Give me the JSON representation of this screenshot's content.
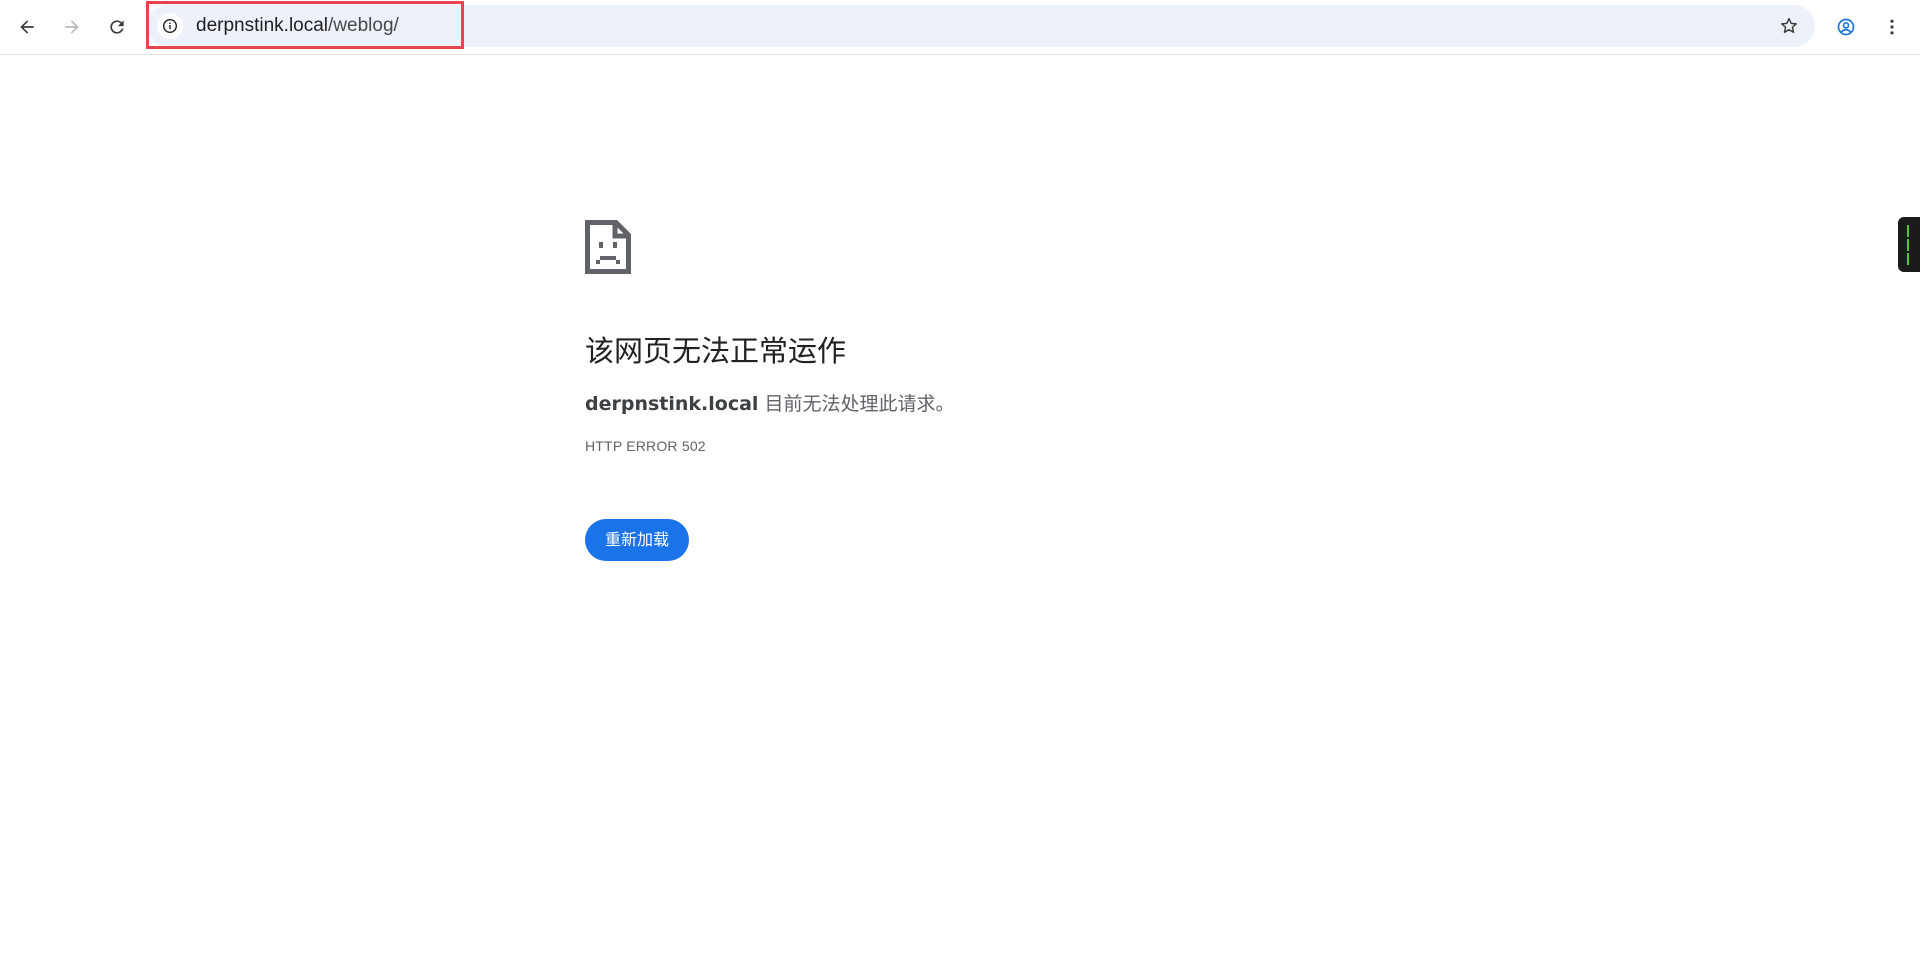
{
  "browser": {
    "url_host": "derpnstink.local",
    "url_path": "/weblog/",
    "icons": {
      "back": "arrow-left-icon",
      "forward": "arrow-right-icon",
      "reload": "reload-icon",
      "site_info": "info-icon",
      "bookmark": "star-icon",
      "profile": "account-circle-icon",
      "menu": "kebab-menu-icon"
    },
    "accent_color": "#1a73e8",
    "highlight_color": "#e8444f"
  },
  "error_page": {
    "icon": "sad-page-icon",
    "title": "该网页无法正常运作",
    "host": "derpnstink.local",
    "message": " 目前无法处理此请求。",
    "error_code": "HTTP ERROR 502",
    "reload_label": "重新加载"
  }
}
